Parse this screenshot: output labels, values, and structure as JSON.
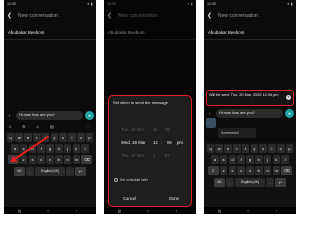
{
  "status": {
    "time": "12:00",
    "icons": "▾ ▮"
  },
  "header": {
    "title": "New conversation"
  },
  "recipient": "Abubakar Beebom",
  "composer": {
    "message": "Hi man how are you?",
    "send": "➤"
  },
  "keyboard": {
    "row1": [
      "q",
      "w",
      "e",
      "r",
      "t",
      "y",
      "u",
      "i",
      "o",
      "p"
    ],
    "row2": [
      "a",
      "s",
      "d",
      "f",
      "g",
      "h",
      "j",
      "k",
      "l"
    ],
    "row3": [
      "z",
      "x",
      "c",
      "v",
      "b",
      "n",
      "m"
    ],
    "shift": "⇧",
    "backspace": "⌫",
    "bottom_left": "!#1",
    "comma": ",",
    "space": "English (UK)",
    "period": ".",
    "enter": "↵"
  },
  "dialog": {
    "title": "Set when to send the message",
    "rows": [
      {
        "day": "Tue, 18 Mar",
        "hour": "11",
        "min": "05",
        "ampm": ""
      },
      {
        "day": "Wed, 19 Mar",
        "hour": "12",
        "min": "06",
        "ampm": "pm"
      },
      {
        "day": "Thu, 20 Mar",
        "hour": "1",
        "min": "07",
        "ampm": ""
      }
    ],
    "colon": ":",
    "schedule_later": "Set schedule later",
    "cancel": "Cancel",
    "done": "Done"
  },
  "scheduled": {
    "text": "Will be sent: Thu, 20 Mar, 2025 12:06 pm",
    "close": "×"
  },
  "attachment": {
    "label": "Screenshot"
  },
  "colors": {
    "accent_red": "#e02020",
    "send_teal": "#1fa3a3"
  }
}
